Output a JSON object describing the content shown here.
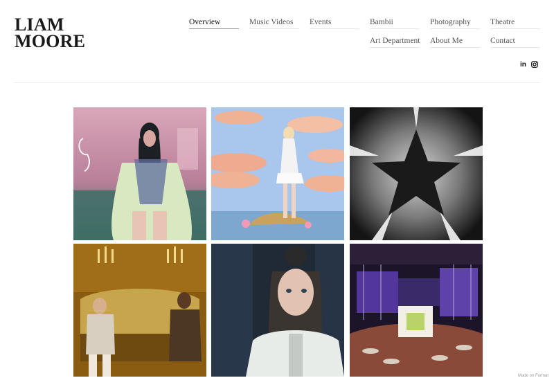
{
  "site": {
    "logo_line1": "LIAM",
    "logo_line2": "MOORE"
  },
  "nav": {
    "overview": "Overview",
    "music_videos": "Music Videos",
    "events": "Events",
    "bambii": "Bambii",
    "photography": "Photography",
    "theatre": "Theatre",
    "art_department": "Art Department",
    "about_me": "About Me",
    "contact": "Contact",
    "active": "Overview"
  },
  "social": {
    "linkedin_icon": "linkedin-icon",
    "linkedin_glyph": "in",
    "instagram_icon": "instagram-icon"
  },
  "gallery": {
    "tiles": [
      {
        "name": "woman-sitting-neon-room",
        "colors": [
          "#c98fa6",
          "#4d6f5e"
        ]
      },
      {
        "name": "woman-standing-on-rock-sky",
        "colors": [
          "#a9c6ec",
          "#f0b295"
        ]
      },
      {
        "name": "star-light-sculpture",
        "colors": [
          "#1a1a1a",
          "#f2f2f2"
        ]
      },
      {
        "name": "men-on-ornate-sofa",
        "colors": [
          "#8a5c12",
          "#d7b04a"
        ]
      },
      {
        "name": "portrait-girl-jacket",
        "colors": [
          "#1f2a36",
          "#e8ece8"
        ]
      },
      {
        "name": "event-venue-purple-lights",
        "colors": [
          "#5a3aa8",
          "#d66a3a"
        ]
      }
    ]
  },
  "footer": {
    "corner_label": "Made on Format"
  }
}
